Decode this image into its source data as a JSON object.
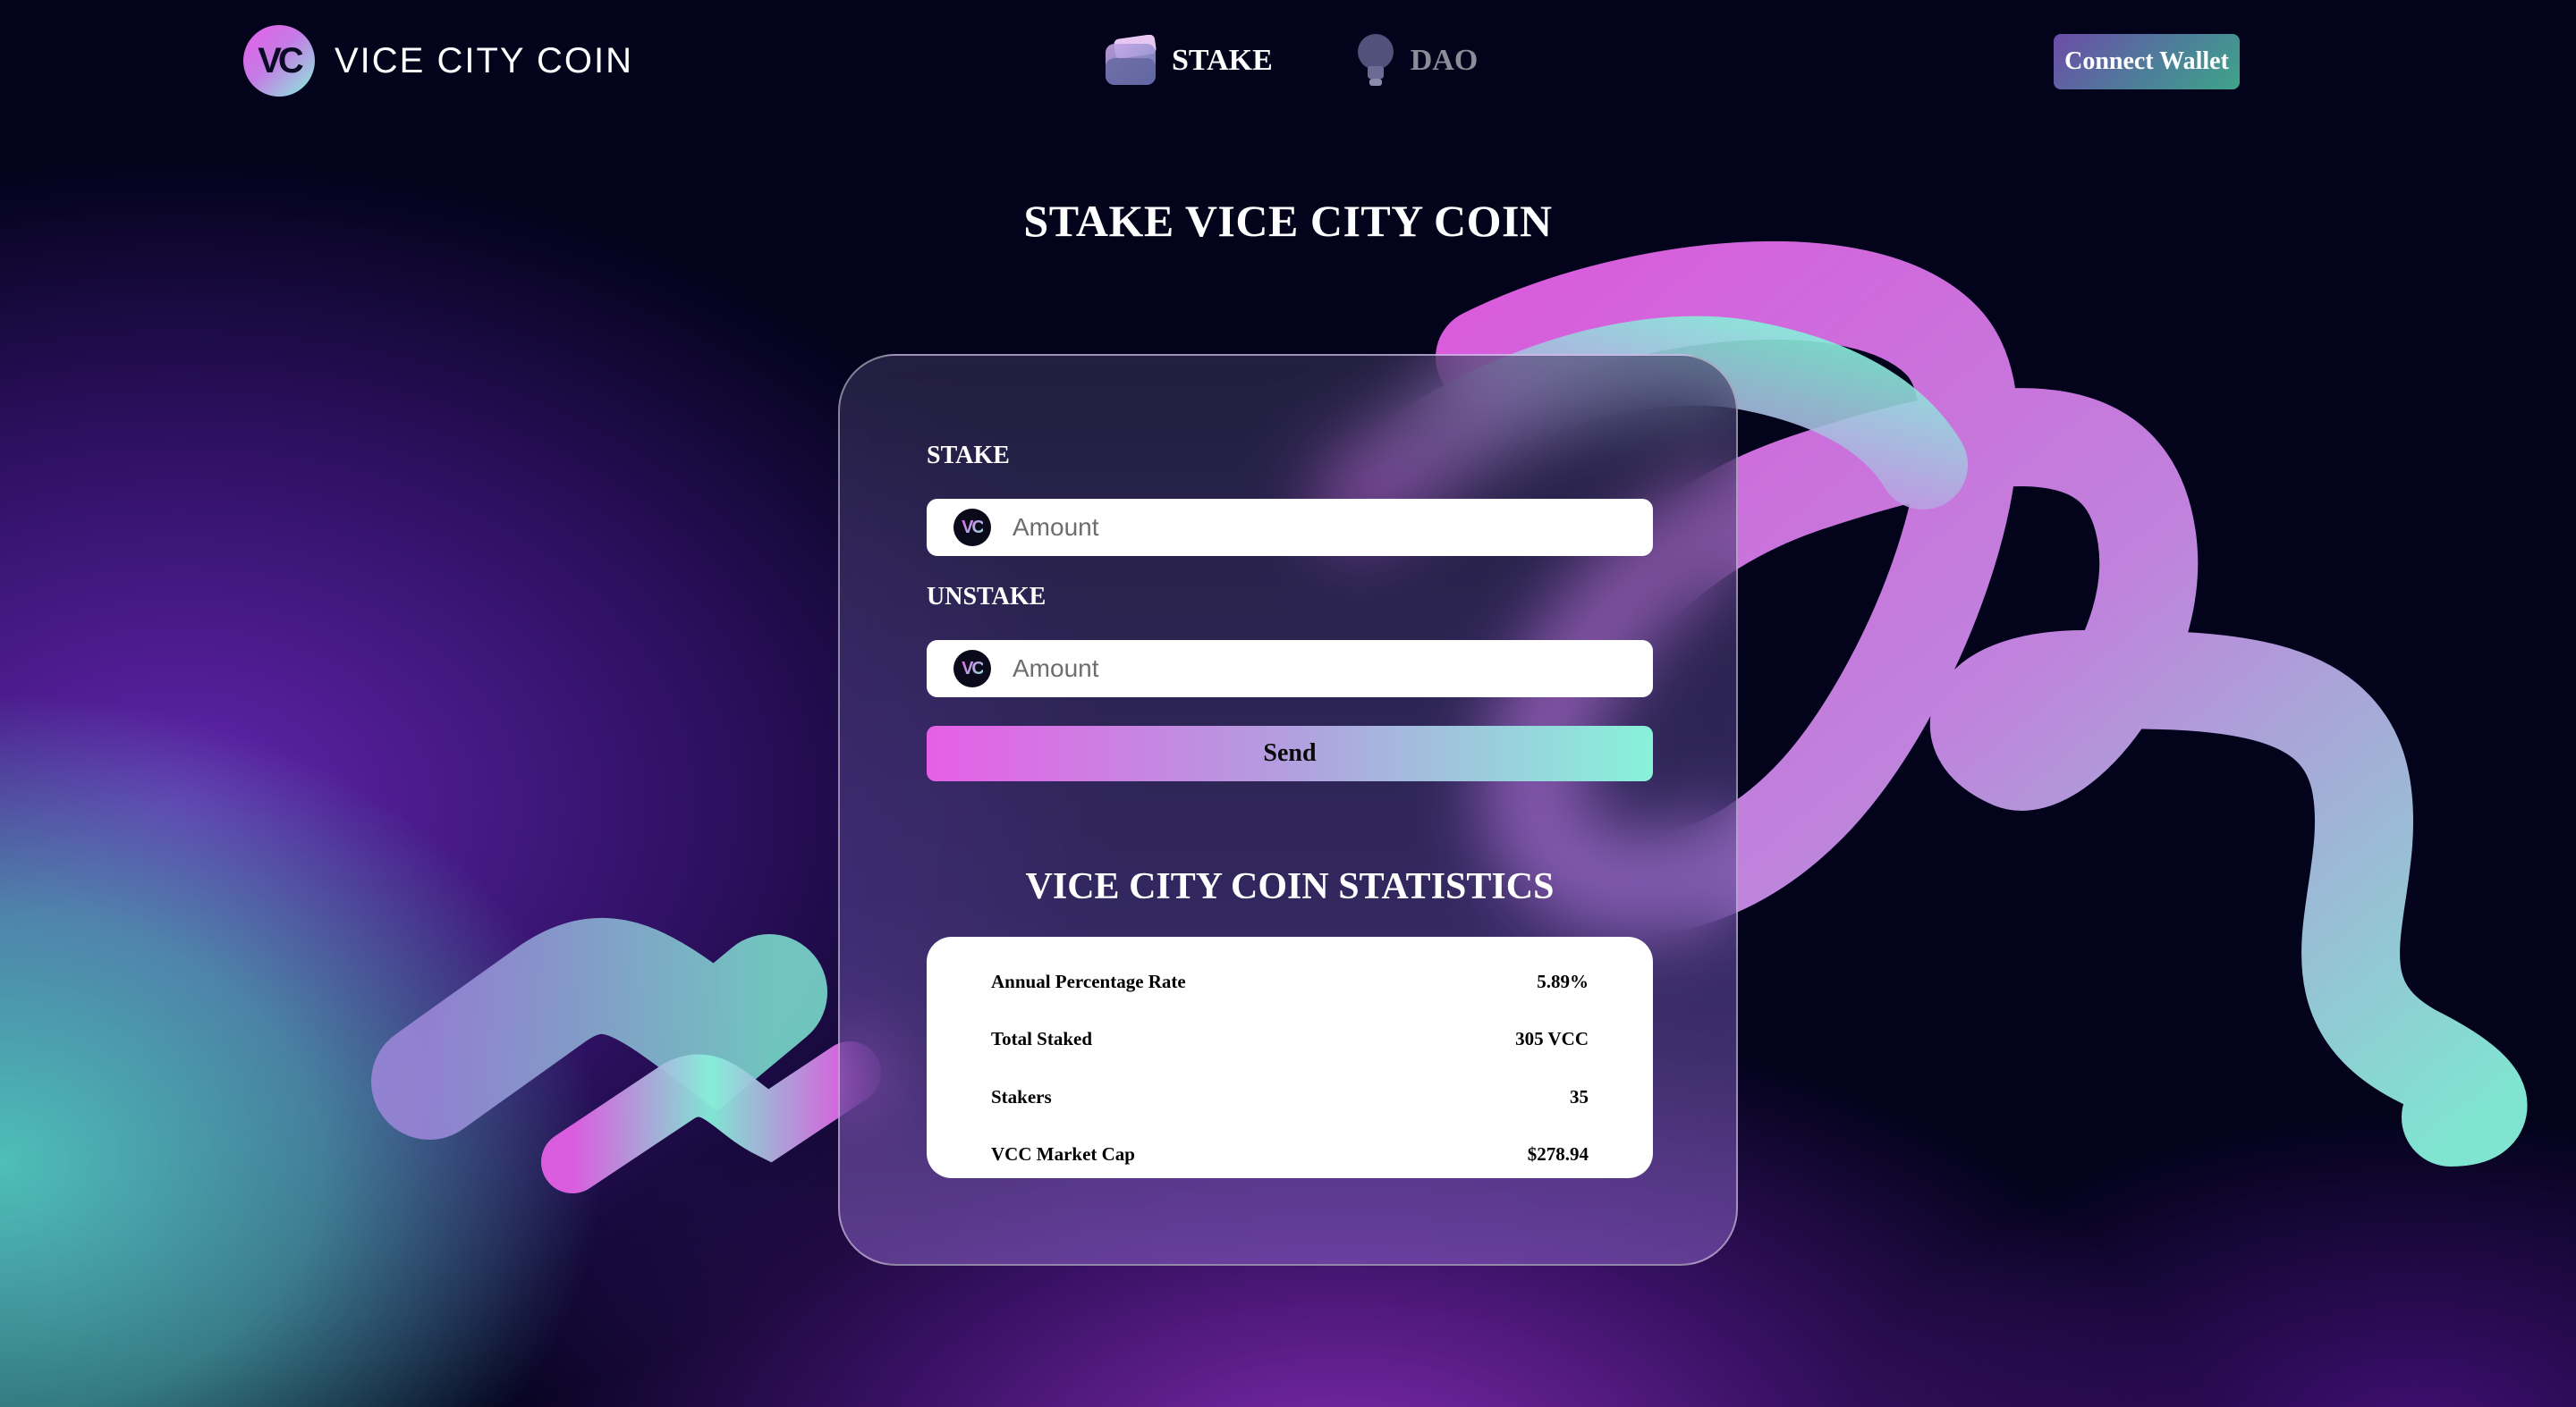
{
  "header": {
    "logo_mark": "VC",
    "logo_text": "VICE CITY COIN",
    "nav": [
      {
        "label": "STAKE",
        "icon": "wallet-icon",
        "active": true
      },
      {
        "label": "DAO",
        "icon": "lightbulb-icon",
        "active": false
      }
    ],
    "connect_wallet_label": "Connect Wallet"
  },
  "main": {
    "title": "STAKE VICE CITY COIN",
    "stake": {
      "label": "STAKE",
      "placeholder": "Amount",
      "value": ""
    },
    "unstake": {
      "label": "UNSTAKE",
      "placeholder": "Amount",
      "value": ""
    },
    "send_label": "Send",
    "stats_title": "VICE CITY COIN STATISTICS",
    "stats": [
      {
        "label": "Annual Percentage Rate",
        "value": "5.89%"
      },
      {
        "label": "Total Staked",
        "value": "305 VCC"
      },
      {
        "label": "Stakers",
        "value": "35"
      },
      {
        "label": "VCC Market Cap",
        "value": "$278.94"
      }
    ]
  },
  "colors": {
    "background": "#03031c",
    "accent_pink": "#e65fe6",
    "accent_mint": "#88f2da",
    "inactive_nav": "#8d8d9a"
  }
}
